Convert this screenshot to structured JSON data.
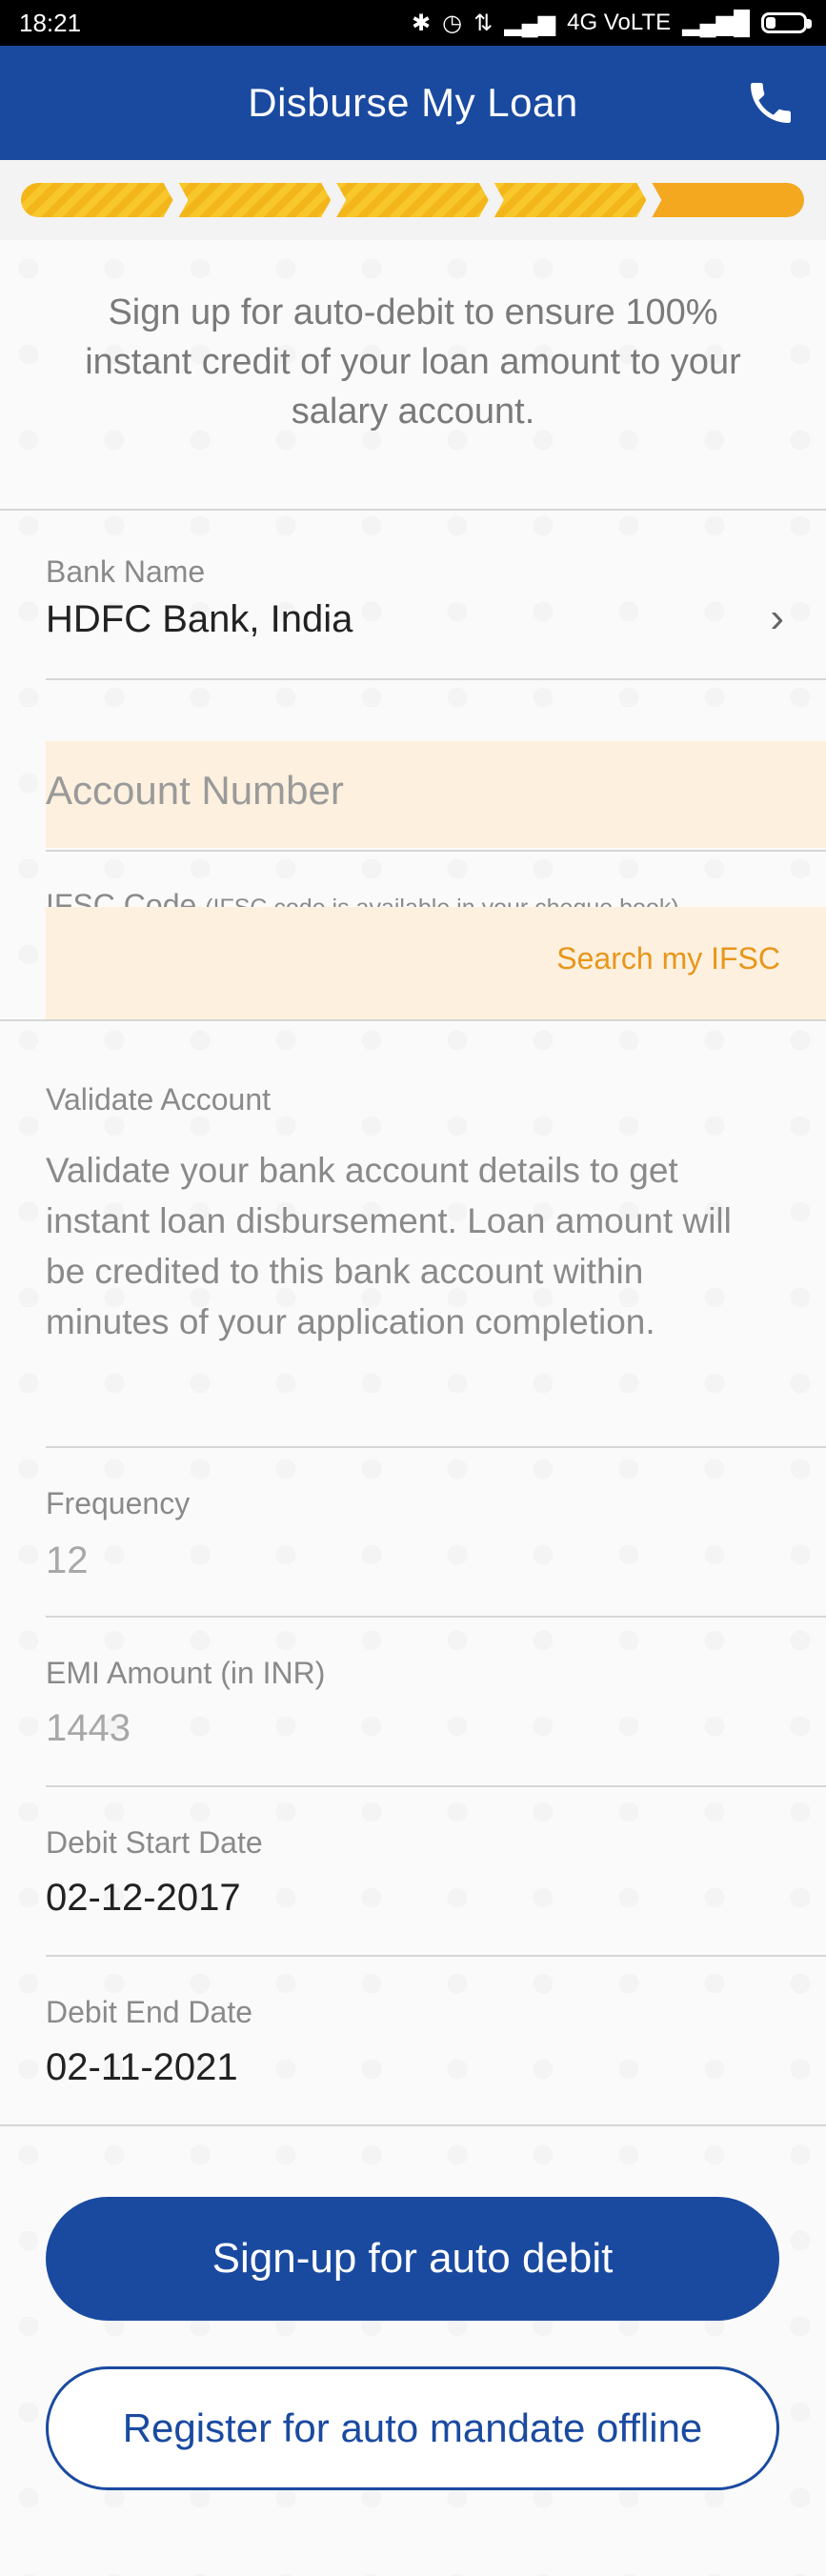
{
  "status_bar": {
    "time": "18:21",
    "network": "4G VoLTE",
    "icons": [
      "bluetooth-icon",
      "alarm-icon",
      "data-arrows-icon",
      "signal-icon",
      "signal-icon",
      "battery-icon"
    ]
  },
  "header": {
    "title": "Disburse My Loan",
    "call_icon": "phone-icon"
  },
  "progress": {
    "completed_steps": 4,
    "total_steps": 5
  },
  "intro": {
    "text": "Sign up for auto-debit to ensure 100% instant credit of your loan amount to your salary account."
  },
  "bank": {
    "label": "Bank Name",
    "value": "HDFC Bank, India"
  },
  "account": {
    "placeholder": "Account Number"
  },
  "ifsc": {
    "label": "IFSC Code",
    "hint": "(IFSC code is available in your cheque book)",
    "search_link": "Search my IFSC"
  },
  "validate": {
    "title": "Validate Account",
    "text": "Validate your bank account details to get instant loan disbursement. Loan amount will be credited to this bank account within minutes of your application completion."
  },
  "frequency": {
    "label": "Frequency",
    "value": "12"
  },
  "emi": {
    "label": "EMI Amount (in INR)",
    "value": "1443"
  },
  "debit_start": {
    "label": "Debit Start Date",
    "value": "02-12-2017"
  },
  "debit_end": {
    "label": "Debit End Date",
    "value": "02-11-2021"
  },
  "buttons": {
    "primary": "Sign-up for auto debit",
    "secondary": "Register for auto mandate offline"
  },
  "colors": {
    "brand_blue": "#1a4aa0",
    "accent_orange": "#e8961b",
    "progress_yellow": "#f7c72c",
    "input_bg": "#fdf0de"
  }
}
